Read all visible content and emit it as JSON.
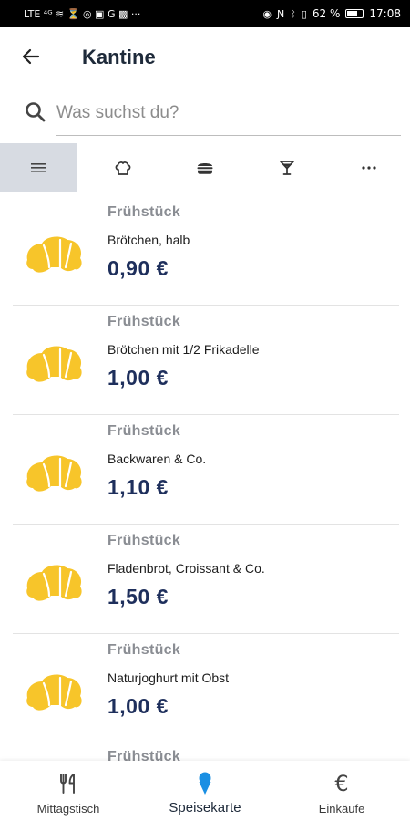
{
  "status_bar": {
    "left_text": "LTE ⁴ᴳ ≋ ⏳ ◎ ▣ G ▩ ···",
    "battery_text": "62 %",
    "time": "17:08"
  },
  "header": {
    "title": "Kantine"
  },
  "search": {
    "placeholder": "Was suchst du?",
    "value": ""
  },
  "tabs": [
    {
      "icon": "menu-lines-icon",
      "active": true
    },
    {
      "icon": "chef-hat-icon",
      "active": false
    },
    {
      "icon": "burger-icon",
      "active": false
    },
    {
      "icon": "cocktail-icon",
      "active": false
    },
    {
      "icon": "more-icon",
      "active": false
    }
  ],
  "menu_items": [
    {
      "category": "Frühstück",
      "name": "Brötchen, halb",
      "price": "0,90 €",
      "icon": "croissant-icon"
    },
    {
      "category": "Frühstück",
      "name": "Brötchen mit 1/2 Frikadelle",
      "price": "1,00 €",
      "icon": "croissant-icon"
    },
    {
      "category": "Frühstück",
      "name": "Backwaren & Co.",
      "price": "1,10 €",
      "icon": "croissant-icon"
    },
    {
      "category": "Frühstück",
      "name": "Fladenbrot, Croissant & Co.",
      "price": "1,50 €",
      "icon": "croissant-icon"
    },
    {
      "category": "Frühstück",
      "name": "Naturjoghurt mit Obst",
      "price": "1,00 €",
      "icon": "croissant-icon"
    },
    {
      "category": "Frühstück"
    }
  ],
  "bottom_nav": [
    {
      "label": "Mittagstisch",
      "icon": "cutlery-icon",
      "active": false
    },
    {
      "label": "Speisekarte",
      "icon": "ice-cream-icon",
      "active": true
    },
    {
      "label": "Einkäufe",
      "icon": "euro-icon",
      "active": false
    }
  ],
  "colors": {
    "accent": "#1a8fe3",
    "price": "#1e2f5c",
    "croissant": "#f7c52a",
    "active_tab_bg": "#d7dbe2"
  }
}
